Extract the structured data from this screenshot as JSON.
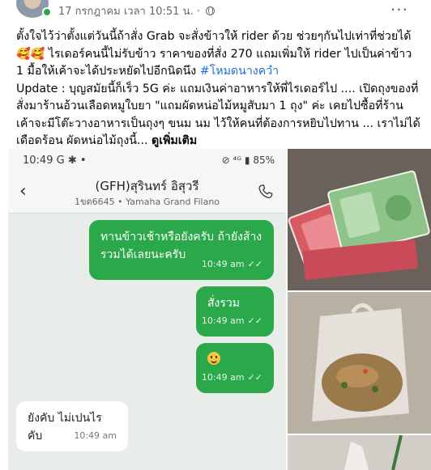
{
  "post": {
    "timestamp": "17 กรกฎาคม เวลา 10:51 น.",
    "separator": "·",
    "more_label": "...",
    "text_line1": "ตั้งใจไว้ว่าตั้งแต่วันนี้ถ้าสั่ง Grab จะสั่งข้าวให้ rider ด้วย ช่วยๆกันไปเท่าที่ช่วยได้ 🥰🥰 ไรเดอร์คนนี้ไม่รับข้าว ราคาของที่สั่ง 270 แถมเพิ่มให้ rider ไปเป็นค่าข้าว 1 มื้อให้เค้าจะได้ประหยัดไปอีกนิดนึง ",
    "hashtag": "#โหมดนางควํา",
    "text_line2": " Update : บุญสมัยนี้ก็เร็ว 5G ค่ะ แถมเงินค่าอาหารให้พี่ไรเดอร์ไป .... เปิดถุงของที่สั่งมาร้านอ้วนเลือดหมูใบยา \"แถมผัดหน่อไม้หมูสับมา 1 ถุง\" ค่ะ เคยไปซื้อที่ร้านเค้าจะมีโต๊ะวางอาหารเป็นถุงๆ ขนม นม ไว้ให้คนที่ต้องการหยิบไปทาน ... เราไม่ได้เดือดร้อน ผัดหน่อไม้ถุงนี้... ",
    "see_more": "ดูเพิ่มเติม"
  },
  "chat": {
    "status_time": "10:49",
    "status_icons": "G ✱ •",
    "status_right": "⊘ ⁴ᴳ ▮ 85%",
    "back_icon": "‹",
    "contact_name": "(GFH)สุรินทร์ อิสุวรี",
    "contact_sub": "1ขต6645 • Yamaha Grand Filano",
    "messages": [
      {
        "text": "ทานข้าวเช้าหรือยังครับ ถ้ายังส้างรวมได้เลยนะครับ",
        "time": "10:49 am",
        "dir": "out"
      },
      {
        "text": "สั่งรวม",
        "time": "10:49 am",
        "dir": "out"
      },
      {
        "text": "",
        "time": "10:49 am",
        "dir": "out",
        "emoji": "smile"
      },
      {
        "text": "ยังคับ ไม่เปนไรคับ",
        "time": "10:49 am",
        "dir": "in"
      }
    ],
    "read_ticks": "✓✓",
    "accent_color": "#2ba84a"
  },
  "photos": {
    "money_icon": "banknotes-photo",
    "bag_icon": "food-bag-photo",
    "bag2_icon": "plastic-bag-photo"
  }
}
